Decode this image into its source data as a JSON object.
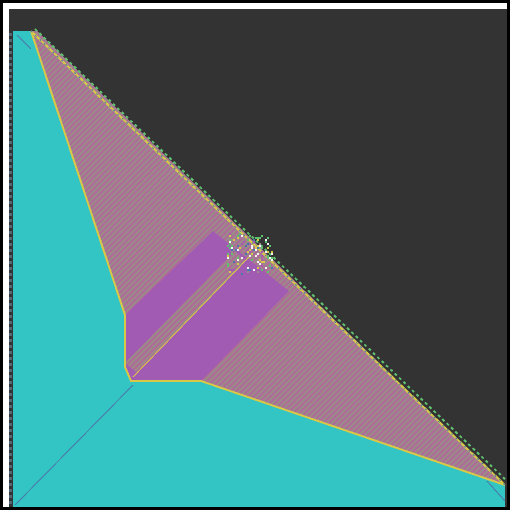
{
  "title": "",
  "palette": {
    "background": "#333333",
    "frame": "#000000",
    "matte": "#ffffff",
    "teal": "#33c4c4",
    "magenta": "#a15bb3",
    "stripe_a": "#b06a9a",
    "stripe_b": "#9a8a88",
    "edge_yellow": "#d7c848",
    "edge_green": "#5fc070",
    "edge_blue": "#4a78a8",
    "border_dots": "#556677",
    "chaos_white": "#f4f4f4"
  },
  "regions": [
    {
      "name": "dark-background",
      "color_key": "background"
    },
    {
      "name": "teal-region",
      "color_key": "teal"
    },
    {
      "name": "striped-triangle",
      "color_key": "stripe_a"
    },
    {
      "name": "solid-magenta-band",
      "color_key": "magenta"
    },
    {
      "name": "chaotic-cluster",
      "color_key": "chaos_white"
    }
  ]
}
